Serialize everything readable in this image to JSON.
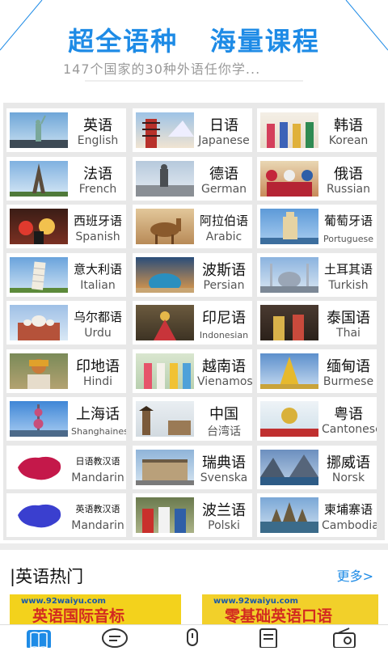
{
  "header": {
    "slogan": "超全语种   海量课程",
    "subtitle": "147个国家的30种外语任你学..."
  },
  "languages": [
    {
      "cn": "英语",
      "en": "English",
      "thumb": "statue-of-liberty"
    },
    {
      "cn": "日语",
      "en": "Japanese",
      "thumb": "pagoda-fuji"
    },
    {
      "cn": "韩语",
      "en": "Korean",
      "thumb": "hanbok-dancers"
    },
    {
      "cn": "法语",
      "en": "French",
      "thumb": "eiffel-tower"
    },
    {
      "cn": "德语",
      "en": "German",
      "thumb": "berlin-statue"
    },
    {
      "cn": "俄语",
      "en": "Russian",
      "thumb": "russian-dancers"
    },
    {
      "cn": "西班牙语",
      "en": "Spanish",
      "thumb": "flamenco"
    },
    {
      "cn": "阿拉伯语",
      "en": "Arabic",
      "thumb": "camel"
    },
    {
      "cn": "葡萄牙语",
      "en": "Portuguese",
      "thumb": "belem-tower"
    },
    {
      "cn": "意大利语",
      "en": "Italian",
      "thumb": "pisa-tower"
    },
    {
      "cn": "波斯语",
      "en": "Persian",
      "thumb": "blue-dome"
    },
    {
      "cn": "土耳其语",
      "en": "Turkish",
      "thumb": "blue-mosque"
    },
    {
      "cn": "乌尔都语",
      "en": "Urdu",
      "thumb": "badshahi-mosque"
    },
    {
      "cn": "印尼语",
      "en": "Indonesian",
      "thumb": "balinese-dance"
    },
    {
      "cn": "泰国语",
      "en": "Thai",
      "thumb": "thai-dancers"
    },
    {
      "cn": "印地语",
      "en": "Hindi",
      "thumb": "indian-man"
    },
    {
      "cn": "越南语",
      "en": "Vienamose",
      "thumb": "ao-dai"
    },
    {
      "cn": "缅甸语",
      "en": "Burmese",
      "thumb": "shwedagon"
    },
    {
      "cn": "上海话",
      "en": "Shanghainese",
      "thumb": "pearl-tower"
    },
    {
      "cn": "中国",
      "en": "台湾话",
      "thumb": "chinese-pagoda"
    },
    {
      "cn": "粤语",
      "en": "Cantonese",
      "thumb": "bauhinia"
    },
    {
      "cn": "日语教汉语",
      "en": "Mandarin",
      "thumb": "china-map-red"
    },
    {
      "cn": "瑞典语",
      "en": "Svenska",
      "thumb": "stockholm-palace"
    },
    {
      "cn": "挪威语",
      "en": "Norsk",
      "thumb": "fjord"
    },
    {
      "cn": "英语教汉语",
      "en": "Mandarin",
      "thumb": "china-map-blue"
    },
    {
      "cn": "波兰语",
      "en": "Polski",
      "thumb": "polish-folk"
    },
    {
      "cn": "柬埔寨语",
      "en": "Cambodia",
      "thumb": "angkor-wat"
    }
  ],
  "section": {
    "title": "|英语热门",
    "more": "更多>"
  },
  "banners": [
    {
      "url": "www.92waiyu.com",
      "headline": "英语国际音标"
    },
    {
      "url": "www.92waiyu.com",
      "headline": "零基础英语口语"
    }
  ],
  "tabs": [
    {
      "icon": "book-icon",
      "active": true
    },
    {
      "icon": "chat-bubble-icon",
      "active": false
    },
    {
      "icon": "microphone-icon",
      "active": false
    },
    {
      "icon": "document-icon",
      "active": false
    },
    {
      "icon": "radio-icon",
      "active": false
    }
  ],
  "colors": {
    "accent": "#1e8be6",
    "banner": "#f3d21c",
    "banner_text": "#d32a20"
  }
}
